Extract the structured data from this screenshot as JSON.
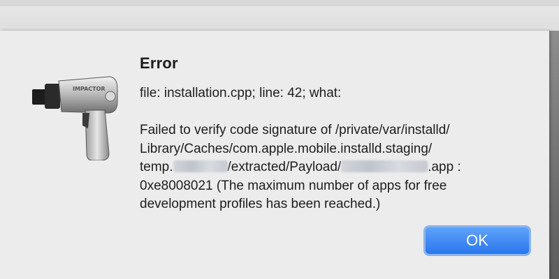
{
  "dialog": {
    "title": "Error",
    "icon": "impact-wrench-icon",
    "info": "file: installation.cpp; line: 42; what:",
    "message": {
      "line1": "Failed to verify code signature of /private/var/installd/",
      "line2": "Library/Caches/com.apple.mobile.installd.staging/",
      "line3_prefix": "temp.",
      "line3_middle": "/extracted/Payload/",
      "line3_suffix": ".app :",
      "line4": "0xe8008021 (The maximum number of apps for free",
      "line5": "development profiles has been reached.)"
    },
    "ok_label": "OK",
    "icon_text": "IMPACTOR"
  },
  "colors": {
    "button_top": "#5fa3f8",
    "button_bottom": "#2a76ee",
    "dialog_bg": "#ececec"
  }
}
